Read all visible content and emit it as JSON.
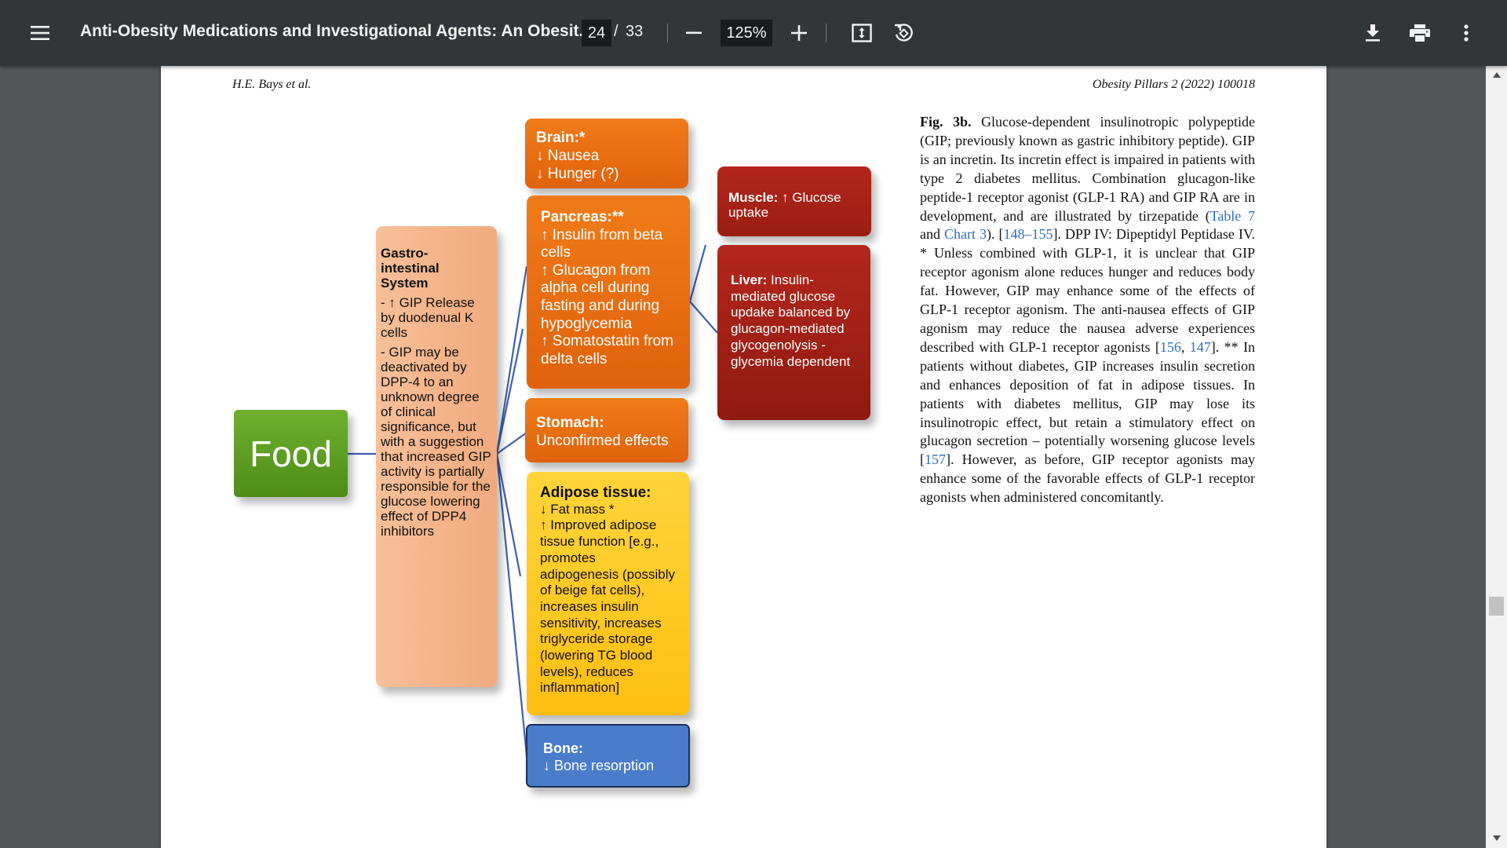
{
  "toolbar": {
    "menu_icon": "hamburger-menu-icon",
    "title": "Anti-Obesity Medications and Investigational Agents: An Obesit...",
    "page_current": "24",
    "page_separator": "/",
    "page_total": "33",
    "zoom_value": "125%",
    "icons": {
      "zoom_out": "minus-icon",
      "zoom_in": "plus-icon",
      "fit": "fit-to-page-icon",
      "rotate": "rotate-counterclockwise-icon",
      "download": "download-icon",
      "print": "print-icon",
      "more": "more-vertical-icon"
    }
  },
  "page": {
    "running_head_left": "H.E. Bays et al.",
    "running_head_right": "Obesity Pillars 2 (2022) 100018",
    "figure": {
      "food": "Food",
      "gi": {
        "title_lines": [
          "Gastro-",
          "intestinal",
          "System"
        ],
        "para1": "- ↑ GIP Release by duodenual K cells",
        "para2": "- GIP may be deactivated by DPP-4 to an unknown degree of clinical significance,  but with a suggestion that  increased GIP activity is partially responsible for the glucose lowering effect of DPP4 inhibitors"
      },
      "brain": {
        "title": "Brain:*",
        "lines": [
          "↓ Nausea",
          "↓ Hunger (?)"
        ]
      },
      "pancreas": {
        "title": "Pancreas:**",
        "lines": [
          "↑ Insulin from beta cells",
          "↑ Glucagon from alpha cell during fasting and during hypoglycemia",
          "↑ Somatostatin from delta cells"
        ]
      },
      "stomach": {
        "title": "Stomach:",
        "lines": [
          "Unconfirmed effects"
        ]
      },
      "adipose": {
        "title": "Adipose tissue:",
        "lines": [
          "↓ Fat mass *",
          "↑ Improved adipose tissue function [e.g., promotes adipogenesis (possibly of beige fat cells), increases insulin sensitivity, increases triglyceride storage (lowering TG blood levels), reduces inflammation]"
        ]
      },
      "bone": {
        "title": "Bone:",
        "lines": [
          "↓ Bone resorption"
        ]
      },
      "muscle": {
        "title": "Muscle:",
        "text": " ↑ Glucose uptake"
      },
      "liver": {
        "title": "Liver:",
        "text": " Insulin-mediated glucose updake balanced by  glucagon-mediated glycogenolysis - glycemia dependent"
      }
    },
    "caption": {
      "label": "Fig.   3b.",
      "part1": " Glucose-dependent insulinotropic polypeptide (GIP; previously known as gastric inhibitory peptide). GIP is an incretin. Its incretin effect is impaired in patients with type 2 diabetes mellitus. Combination glucagon-like peptide-1 receptor agonist (GLP-1 RA) and GIP RA are in development, and are illustrated by tirzepatide (",
      "link_table": "Table 7",
      "and": " and ",
      "link_chart": "Chart 3",
      "part2": "). [",
      "link_refs1": "148–155",
      "part3": "]. DPP IV: Dipeptidyl Peptidase IV. * Unless combined with GLP-1, it is unclear that GIP receptor agonism alone reduces hunger and reduces body fat. However, GIP may enhance some of the effects of GLP-1 receptor agonism. The anti-nausea effects of GIP agonism may reduce the nausea adverse experiences described with GLP-1 receptor agonists [",
      "link_ref156": "156",
      "comma": ", ",
      "link_ref147": "147",
      "part4": "]. ** In patients without diabetes, GIP increases insulin secretion and enhances deposition of fat in adipose tissues. In patients with diabetes mellitus, GIP may lose its insulinotropic effect, but retain a stimulatory effect on glucagon secretion – potentially worsening glucose levels [",
      "link_ref157": "157",
      "part5": "]. However, as before, GIP receptor agonists may enhance some of the favorable effects of GLP-1 receptor agonists when administered concomitantly."
    }
  }
}
